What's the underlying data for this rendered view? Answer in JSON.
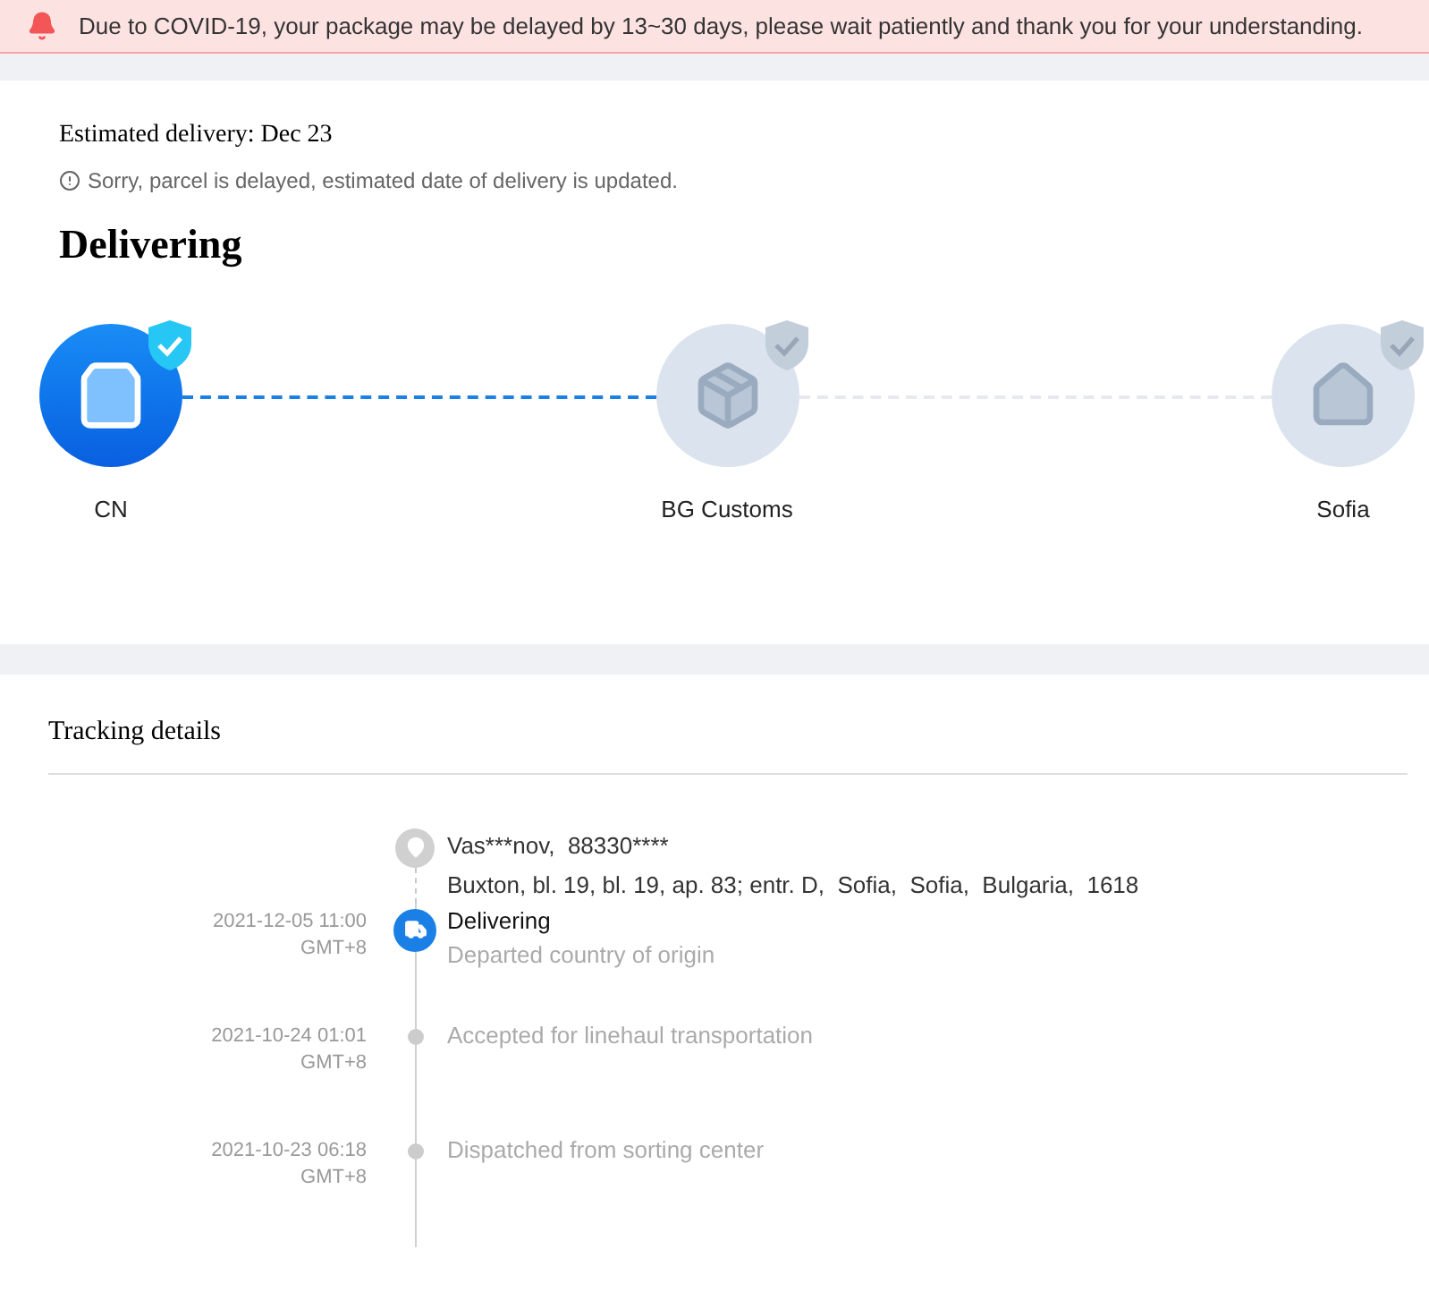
{
  "banner": {
    "text": "Due to COVID-19, your package may be delayed by 13~30 days, please wait patiently and thank you for your understanding."
  },
  "delivery": {
    "estimate": "Estimated delivery: Dec 23",
    "notice": "Sorry, parcel is delayed, estimated date of delivery is updated.",
    "status": "Delivering"
  },
  "steps": [
    {
      "label": "CN",
      "kind": "bag",
      "done": true
    },
    {
      "label": "BG Customs",
      "kind": "box",
      "done": false
    },
    {
      "label": "Sofia",
      "kind": "house",
      "done": false
    }
  ],
  "tracking": {
    "title": "Tracking details",
    "events": [
      {
        "kind": "address",
        "name": "Vas***nov,  88330****",
        "address": "Buxton, bl. 19, bl. 19, ap. 83; entr. D,  Sofia,  Sofia,  Bulgaria,  1618"
      },
      {
        "kind": "event",
        "date": "2021-12-05 11:00",
        "zone": "GMT+8",
        "status": "Delivering",
        "description": "Departed country of origin",
        "current": true
      },
      {
        "kind": "event",
        "date": "2021-10-24 01:01",
        "zone": "GMT+8",
        "description": "Accepted for linehaul transportation",
        "current": false
      },
      {
        "kind": "event",
        "date": "2021-10-23 06:18",
        "zone": "GMT+8",
        "description": "Dispatched from sorting center",
        "current": false
      }
    ]
  }
}
